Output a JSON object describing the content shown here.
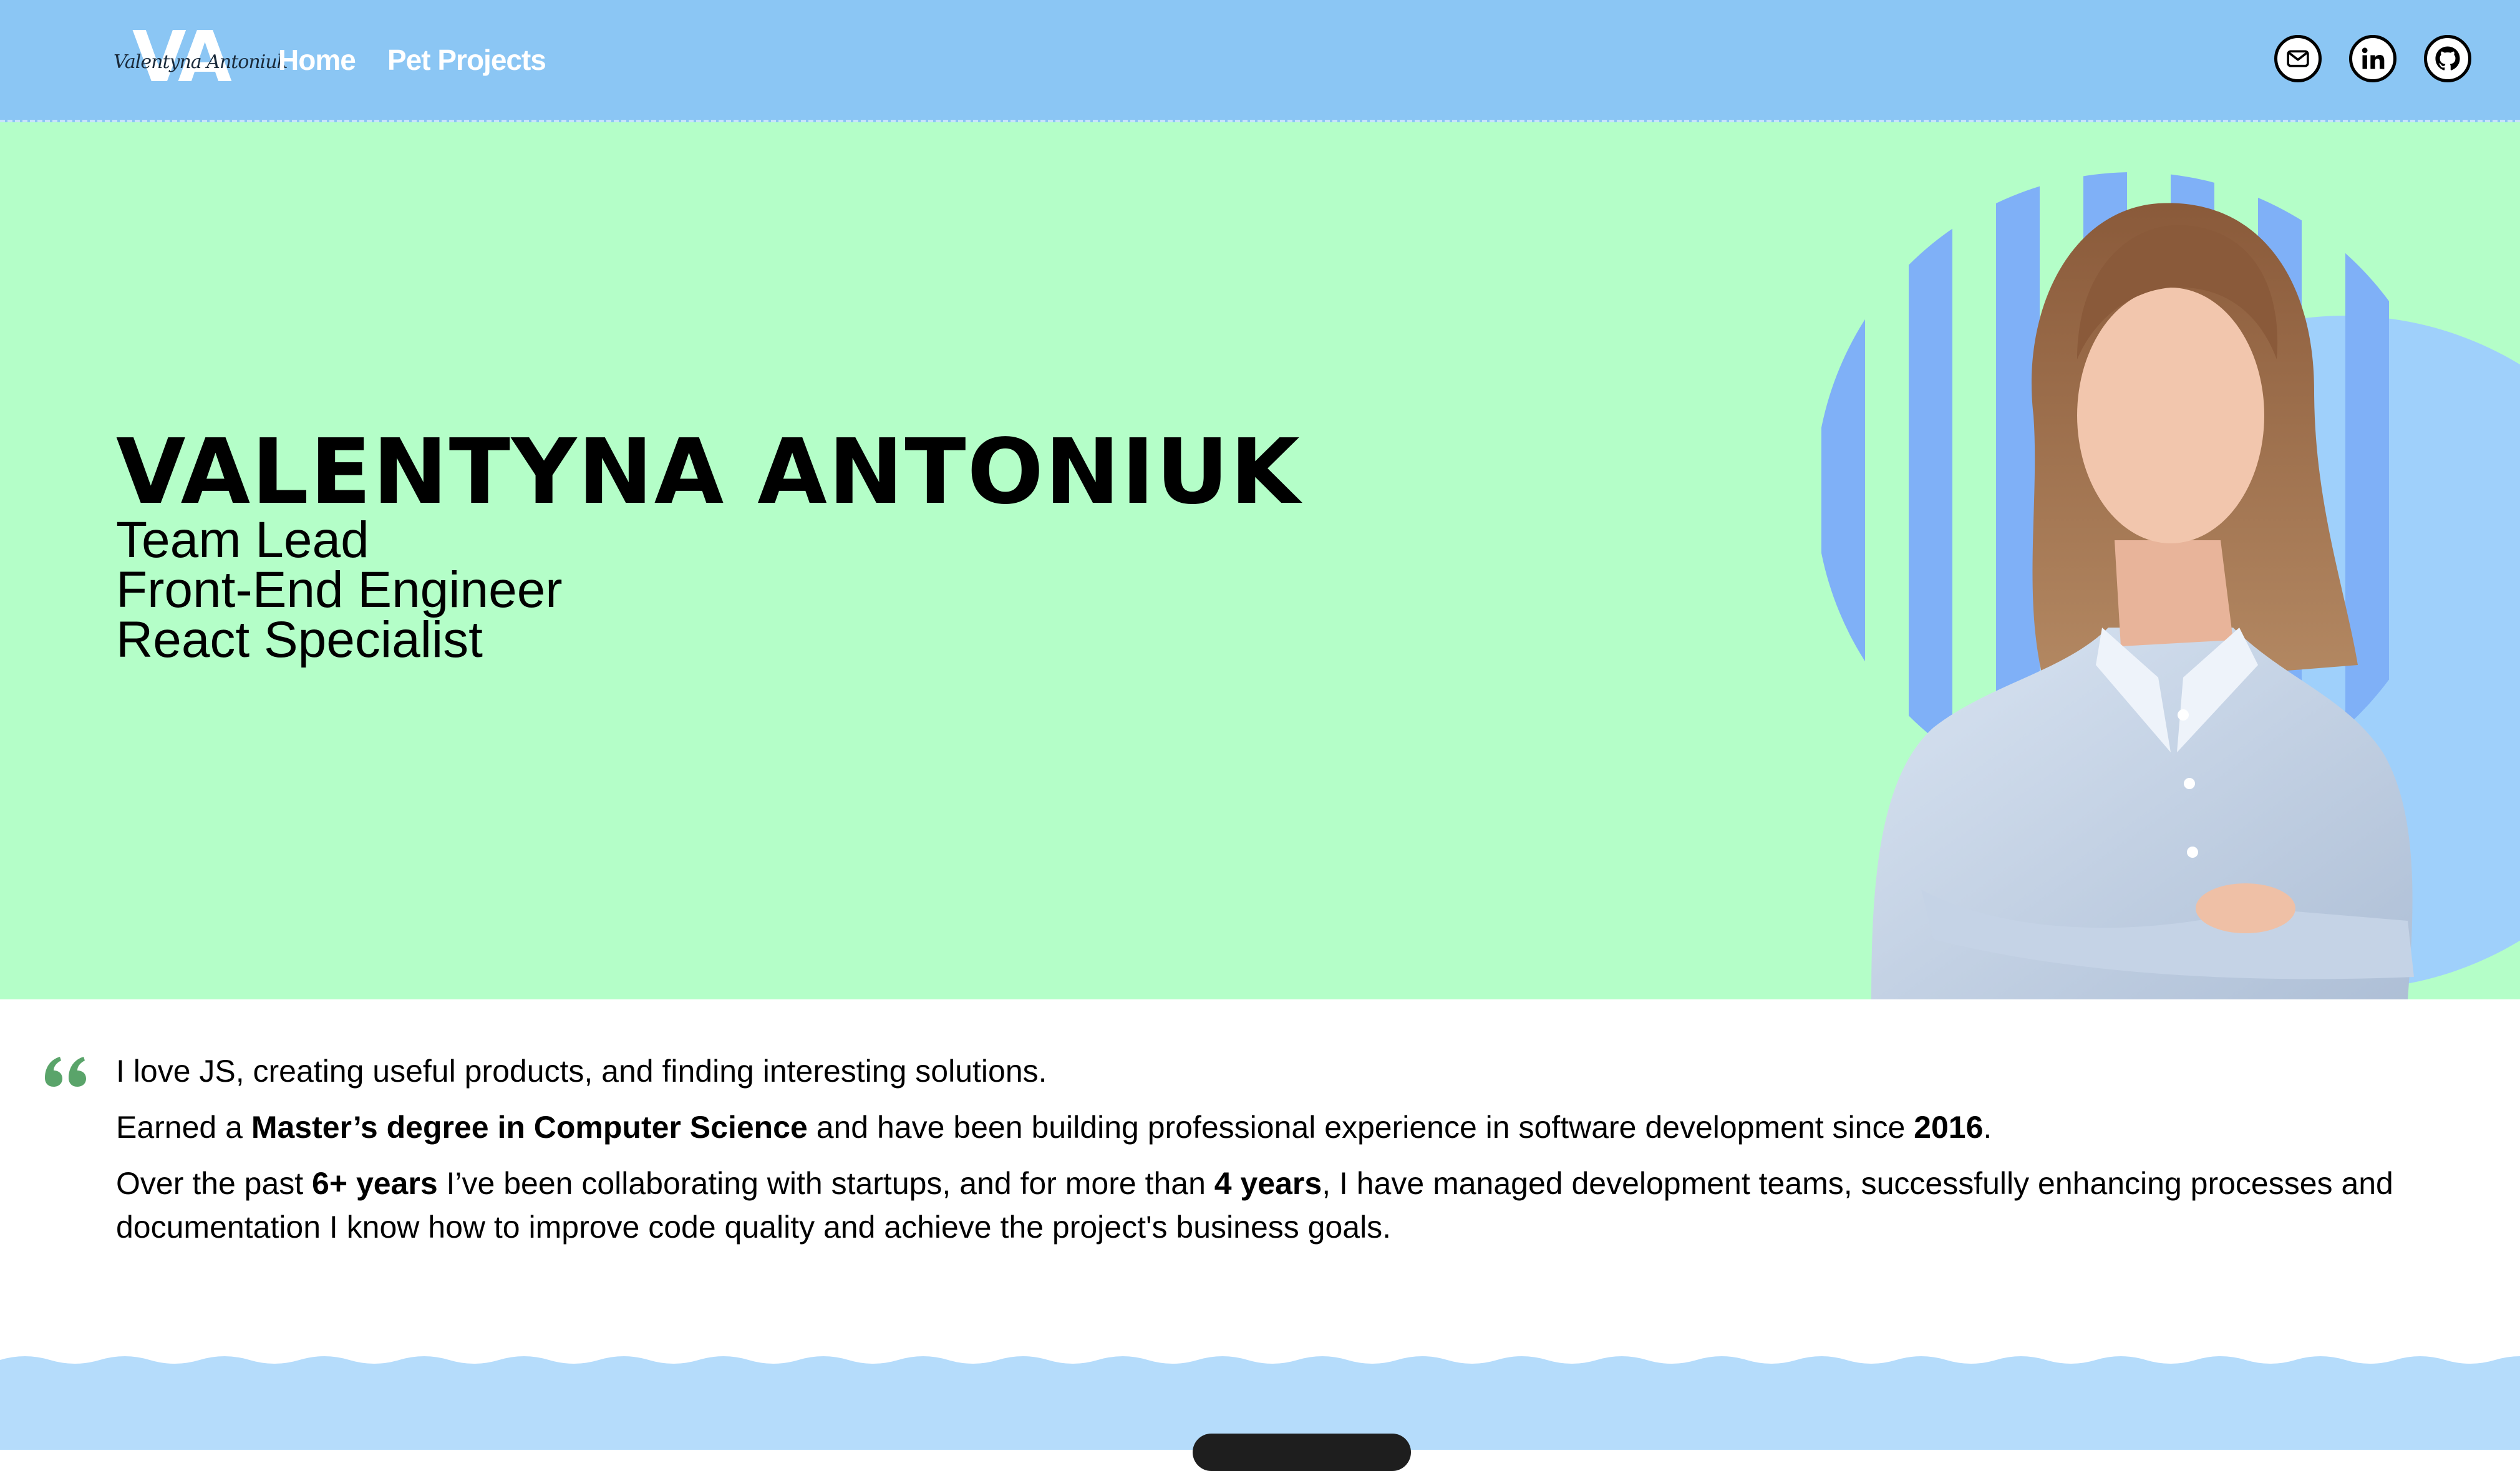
{
  "header": {
    "logo_letters": "VA",
    "logo_script": "Valentyna Antoniuk",
    "nav": [
      {
        "label": "Home"
      },
      {
        "label": "Pet Projects"
      }
    ],
    "social_icons": [
      "mail-icon",
      "linkedin-icon",
      "github-icon"
    ],
    "background": "#8bc6f4"
  },
  "hero": {
    "name": "Valentyna Antoniuk",
    "roles": [
      "Team Lead",
      "Front-End Engineer",
      "React Specialist"
    ],
    "background": "#b4fec8",
    "accent_stripes": "#7fb0f7"
  },
  "about": {
    "quote_icon": "quote-icon",
    "line1": "I love JS, creating useful products, and finding interesting solutions.",
    "line2": {
      "a": "Earned a ",
      "b": "Master’s degree in Computer Science",
      "c": " and have been building professional experience in software development since ",
      "d": "2016",
      "e": "."
    },
    "line3": {
      "a": "Over the past ",
      "b": "6+ years",
      "c": " I’ve been collaborating with startups, and for more than ",
      "d": "4 years",
      "e": ", I have managed development teams, successfully enhancing processes and documentation I know how to improve code quality and achieve the project's business goals."
    },
    "quote_color": "#5aa46a"
  },
  "footer": {
    "wave_color": "#b5dcfb"
  }
}
